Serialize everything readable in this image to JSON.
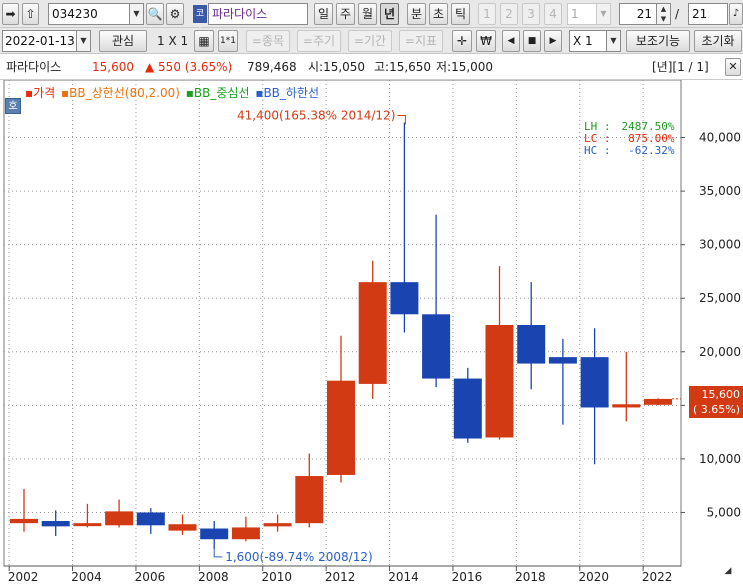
{
  "toolbar1": {
    "code": "034230",
    "stock_name": "파라다이스",
    "market_badge": "코스닥",
    "periods": [
      "일",
      "주",
      "월",
      "년",
      "분",
      "초",
      "틱"
    ],
    "selected_period": "년",
    "pages": [
      "1",
      "2",
      "3",
      "4"
    ],
    "page_select": "1",
    "count_value": "21",
    "count_separator": "/",
    "count_total": "21"
  },
  "toolbar2": {
    "date": "2022-01-13",
    "watch_label": "관심",
    "layout_label": "1 X 1",
    "layout_small": "1*1",
    "item_button": "=종목",
    "cycle_button": "=주기",
    "period_button": "=기간",
    "indicator_button": "=지표",
    "won_symbol": "₩",
    "zoom_value": "X 1",
    "assist_button": "보조기능",
    "reset_button": "초기화"
  },
  "info": {
    "name": "파라다이스",
    "price": "15,600",
    "change": "▲ 550 (3.65%)",
    "volume": "789,468",
    "open": "시:15,050",
    "high": "고:15,650",
    "low": "저:15,000",
    "pagination": "[년][1 / 1]",
    "rise_color": "#e8290b",
    "fall_color": "#1e4fb8"
  },
  "chart_badge": "호",
  "legend": [
    {
      "text": "▪가격",
      "color": "#e8290b"
    },
    {
      "text": "▪BB_상한선(80,2.00)",
      "color": "#e8720c"
    },
    {
      "text": "▪BB_중심선",
      "color": "#17a11d"
    },
    {
      "text": "▪BB_하한선",
      "color": "#2a60c8"
    }
  ],
  "stats": [
    {
      "label": "LH :",
      "value": "2487.50%",
      "color": "#1f9a1f"
    },
    {
      "label": "LC :",
      "value": "875.00%",
      "color": "#e8290b"
    },
    {
      "label": "HC :",
      "value": "-62.32%",
      "color": "#2a60c8"
    }
  ],
  "price_tag": {
    "price": "15,600",
    "pct": "( 3.65%)",
    "color": "#d23a14"
  },
  "chart_data": {
    "type": "candlestick",
    "x": [
      "2002",
      "2003",
      "2004",
      "2005",
      "2006",
      "2007",
      "2008",
      "2009",
      "2010",
      "2011",
      "2012",
      "2013",
      "2014",
      "2015",
      "2016",
      "2017",
      "2018",
      "2019",
      "2020",
      "2021",
      "2022"
    ],
    "open": [
      4000,
      4200,
      3800,
      3800,
      5000,
      3300,
      3500,
      2500,
      3700,
      4000,
      8500,
      17000,
      26500,
      23500,
      17500,
      12000,
      22500,
      19500,
      19500,
      14800,
      15050
    ],
    "high": [
      7200,
      5200,
      5800,
      6200,
      5400,
      4800,
      4200,
      4600,
      4800,
      10500,
      21500,
      28500,
      41400,
      32800,
      18500,
      28000,
      26500,
      21200,
      22200,
      20000,
      15650
    ],
    "low": [
      3200,
      2800,
      3600,
      3600,
      3000,
      2900,
      1600,
      2300,
      3200,
      3600,
      7800,
      15600,
      21800,
      16700,
      11500,
      11800,
      16500,
      13200,
      9500,
      13500,
      15000
    ],
    "close": [
      4400,
      3700,
      4000,
      5100,
      3800,
      3900,
      2500,
      3600,
      4000,
      8400,
      17300,
      26500,
      23500,
      17500,
      11900,
      22500,
      18900,
      18900,
      14800,
      15100,
      15600
    ],
    "y_ticks": [
      5000,
      10000,
      15000,
      20000,
      25000,
      30000,
      35000,
      40000
    ],
    "y_tick_labels": [
      "5,000",
      "10,000",
      "15,000",
      "20,000",
      "25,000",
      "30,000",
      "35,000",
      "40,000"
    ],
    "x_tick_labels": [
      "2002",
      "2004",
      "2006",
      "2008",
      "2010",
      "2012",
      "2014",
      "2016",
      "2018",
      "2020",
      "2022"
    ],
    "ylim": [
      0,
      45000
    ],
    "annotation_high": "41,400(165.38% 2014/12)",
    "annotation_low": "1,600(-89.74% 2008/12)",
    "rise_color": "#d23a14",
    "fall_color": "#1a45b0",
    "grid": true
  }
}
